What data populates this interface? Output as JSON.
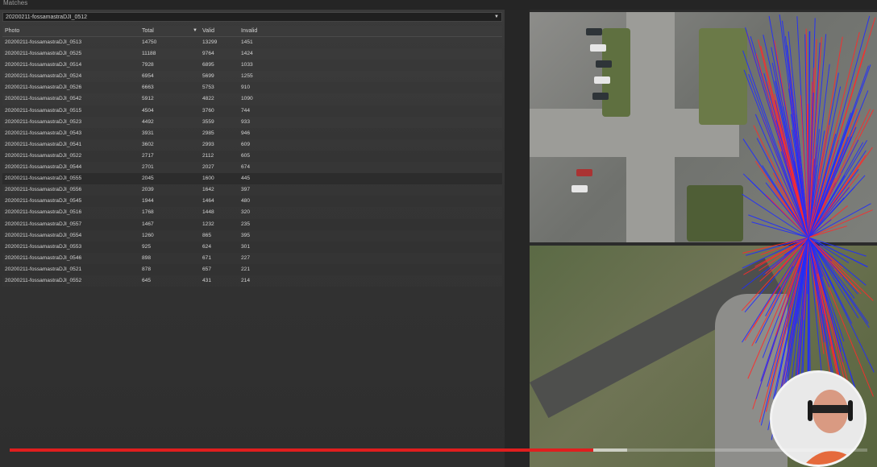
{
  "panel": {
    "title": "Matches"
  },
  "selector": {
    "value": "20200211-fossamastraDJI_0512"
  },
  "table": {
    "headers": {
      "photo": "Photo",
      "total": "Total",
      "valid": "Valid",
      "invalid": "Invalid"
    },
    "rows": [
      {
        "photo": "20200211-fossamastraDJI_0513",
        "total": "14750",
        "valid": "13299",
        "invalid": "1451"
      },
      {
        "photo": "20200211-fossamastraDJI_0525",
        "total": "11188",
        "valid": "9764",
        "invalid": "1424"
      },
      {
        "photo": "20200211-fossamastraDJI_0514",
        "total": "7928",
        "valid": "6895",
        "invalid": "1033"
      },
      {
        "photo": "20200211-fossamastraDJI_0524",
        "total": "6954",
        "valid": "5699",
        "invalid": "1255"
      },
      {
        "photo": "20200211-fossamastraDJI_0526",
        "total": "6663",
        "valid": "5753",
        "invalid": "910"
      },
      {
        "photo": "20200211-fossamastraDJI_0542",
        "total": "5912",
        "valid": "4822",
        "invalid": "1090"
      },
      {
        "photo": "20200211-fossamastraDJI_0515",
        "total": "4504",
        "valid": "3760",
        "invalid": "744"
      },
      {
        "photo": "20200211-fossamastraDJI_0523",
        "total": "4492",
        "valid": "3559",
        "invalid": "933"
      },
      {
        "photo": "20200211-fossamastraDJI_0543",
        "total": "3931",
        "valid": "2985",
        "invalid": "946"
      },
      {
        "photo": "20200211-fossamastraDJI_0541",
        "total": "3602",
        "valid": "2993",
        "invalid": "609"
      },
      {
        "photo": "20200211-fossamastraDJI_0522",
        "total": "2717",
        "valid": "2112",
        "invalid": "605"
      },
      {
        "photo": "20200211-fossamastraDJI_0544",
        "total": "2701",
        "valid": "2027",
        "invalid": "674"
      },
      {
        "photo": "20200211-fossamastraDJI_0555",
        "total": "2045",
        "valid": "1600",
        "invalid": "445"
      },
      {
        "photo": "20200211-fossamastraDJI_0556",
        "total": "2039",
        "valid": "1642",
        "invalid": "397"
      },
      {
        "photo": "20200211-fossamastraDJI_0545",
        "total": "1944",
        "valid": "1464",
        "invalid": "480"
      },
      {
        "photo": "20200211-fossamastraDJI_0516",
        "total": "1768",
        "valid": "1448",
        "invalid": "320"
      },
      {
        "photo": "20200211-fossamastraDJI_0557",
        "total": "1467",
        "valid": "1232",
        "invalid": "235"
      },
      {
        "photo": "20200211-fossamastraDJI_0554",
        "total": "1260",
        "valid": "865",
        "invalid": "395"
      },
      {
        "photo": "20200211-fossamastraDJI_0553",
        "total": "925",
        "valid": "624",
        "invalid": "301"
      },
      {
        "photo": "20200211-fossamastraDJI_0546",
        "total": "898",
        "valid": "671",
        "invalid": "227"
      },
      {
        "photo": "20200211-fossamastraDJI_0521",
        "total": "878",
        "valid": "657",
        "invalid": "221"
      },
      {
        "photo": "20200211-fossamastraDJI_0552",
        "total": "645",
        "valid": "431",
        "invalid": "214"
      }
    ],
    "selected_row": 12
  },
  "icons": {
    "dropdown": "chevron-down-icon",
    "sort": "sort-descending-icon"
  },
  "match_colors": {
    "valid": "#1f2cff",
    "invalid": "#ff2a2a"
  },
  "video": {
    "progress": 0.68,
    "buffered": 0.72,
    "progress_color": "#e01e1e"
  }
}
